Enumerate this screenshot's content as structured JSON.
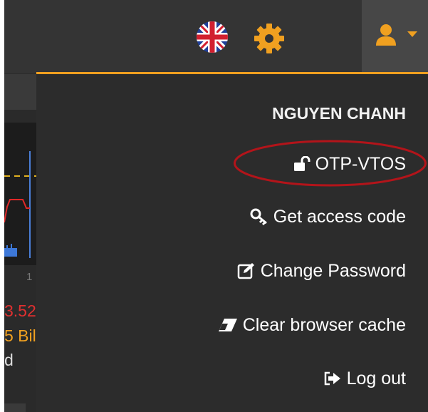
{
  "header": {
    "language_icon": "uk-flag-icon",
    "settings_icon": "gear-icon",
    "user_icon": "user-icon",
    "dropdown_icon": "caret-down-icon",
    "accent_color": "#f0a020"
  },
  "background": {
    "value_text": "3.52",
    "unit_text": "5 Bil",
    "line_text": "d",
    "tick_text": "1"
  },
  "user_menu": {
    "user_name": "NGUYEN CHANH",
    "items": [
      {
        "label": "OTP-VTOS",
        "icon": "unlock-icon"
      },
      {
        "label": "Get access code",
        "icon": "key-icon"
      },
      {
        "label": "Change Password",
        "icon": "edit-icon"
      },
      {
        "label": "Clear browser cache",
        "icon": "eraser-icon"
      },
      {
        "label": "Log out",
        "icon": "sign-out-icon"
      }
    ],
    "highlight_color": "#b3141a"
  }
}
